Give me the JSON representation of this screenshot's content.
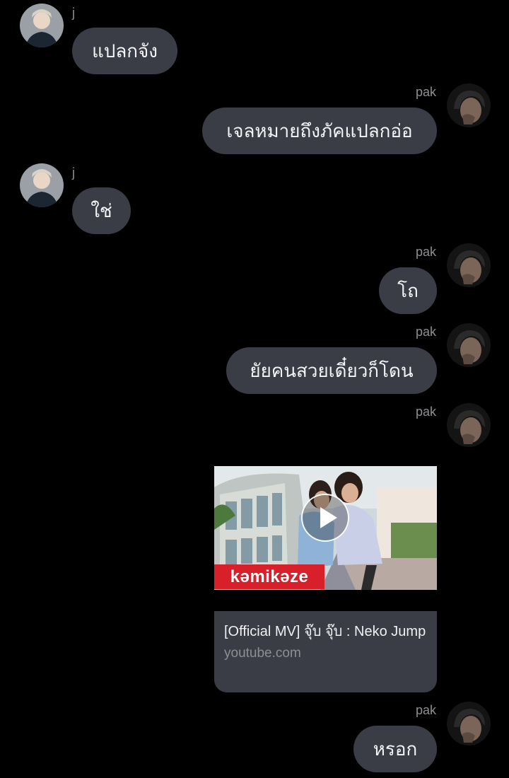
{
  "messages": [
    {
      "sender": "j",
      "text": "แปลกจัง"
    },
    {
      "sender": "pak",
      "text": "เจลหมายถึงภัคแปลกอ่อ"
    },
    {
      "sender": "j",
      "text": "ใช่"
    },
    {
      "sender": "pak",
      "text": "โถ"
    },
    {
      "sender": "pak",
      "text": "ยัยคนสวยเดี๋ยวก็โดน"
    },
    {
      "sender": "pak",
      "text": "หรอก"
    }
  ],
  "link_preview": {
    "sender": "pak",
    "thumbnail_brand": "kəmikəze",
    "title": "[Official MV] จุ๊บ จุ๊บ : Neko Jump",
    "domain": "youtube.com",
    "play_icon": "play-icon"
  },
  "colors": {
    "background": "#000000",
    "bubble": "#3a3d46",
    "sender_name": "#8e8e93",
    "brand_red": "#d8202b"
  }
}
